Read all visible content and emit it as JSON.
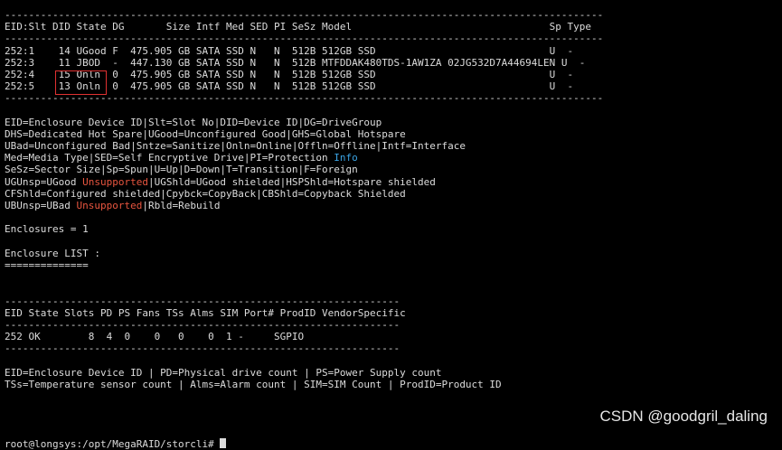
{
  "window": {
    "type": "terminal"
  },
  "terminal": {
    "lines": [
      "----------------------------------------------------------------------------------------------------",
      "EID:Slt DID State DG       Size Intf Med SED PI SeSz Model                                 Sp Type",
      "----------------------------------------------------------------------------------------------------",
      "252:1    14 UGood F  475.905 GB SATA SSD N   N  512B 512GB SSD                             U  -",
      "252:3    11 JBOD  -  447.130 GB SATA SSD N   N  512B MTFDDAK480TDS-1AW1ZA 02JG532D7A44694LEN U  -",
      "252:4    15 Onln  0  475.905 GB SATA SSD N   N  512B 512GB SSD                             U  -",
      "252:5    13 Onln  0  475.905 GB SATA SSD N   N  512B 512GB SSD                             U  -",
      "----------------------------------------------------------------------------------------------------",
      "",
      "EID=Enclosure Device ID|Slt=Slot No|DID=Device ID|DG=DriveGroup",
      "DHS=Dedicated Hot Spare|UGood=Unconfigured Good|GHS=Global Hotspare",
      "UBad=Unconfigured Bad|Sntze=Sanitize|Onln=Online|Offln=Offline|Intf=Interface",
      "Med=Media Type|SED=Self Encryptive Drive|PI=Protection ",
      "SeSz=Sector Size|Sp=Spun|U=Up|D=Down|T=Transition|F=Foreign",
      "UGUnsp=UGood ",
      "CFShld=Configured shielded|Cpybck=CopyBack|CBShld=Copyback Shielded",
      "UBUnsp=UBad ",
      "",
      "Enclosures = 1",
      "",
      "Enclosure LIST :",
      "==============",
      "",
      "",
      "------------------------------------------------------------------",
      "EID State Slots PD PS Fans TSs Alms SIM Port# ProdID VendorSpecific",
      "------------------------------------------------------------------",
      "252 OK        8  4  0    0   0    0  1 -     SGPIO",
      "------------------------------------------------------------------",
      "",
      "EID=Enclosure Device ID | PD=Physical drive count | PS=Power Supply count",
      "TSs=Temperature sensor count | Alms=Alarm count | SIM=SIM Count | ProdID=Product ID",
      "",
      "",
      "",
      "",
      "root@longsys:/opt/MegaRAID/storcli# "
    ],
    "colored": {
      "info": "Info",
      "unsupported_1": "Unsupported",
      "ugunsp_rest": "|UGShld=UGood shielded|HSPShld=Hotspare shielded",
      "unsupported_2": "Unsupported",
      "ubunsp_rest": "|Rbld=Rebuild"
    },
    "colors": {
      "highlight_red": "#e8553f",
      "info_blue": "#3aa3e3",
      "box": "#e03131"
    }
  },
  "watermark": "CSDN @goodgril_daling"
}
